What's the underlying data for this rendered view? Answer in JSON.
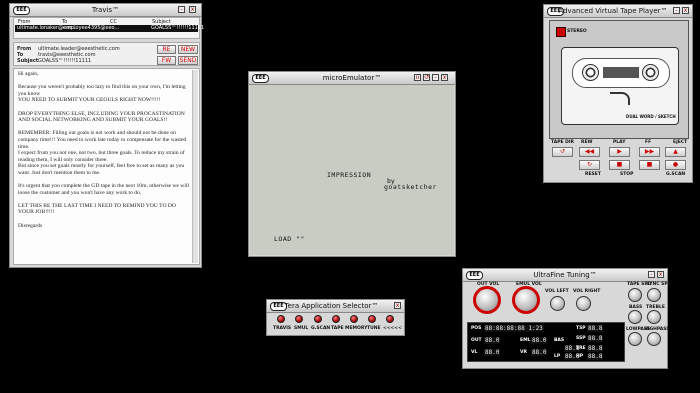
{
  "travis": {
    "title": "Travis™",
    "headers": [
      "From",
      "To",
      "CC",
      "Subject"
    ],
    "row": [
      "ultimate.lonaker@eeo...",
      "employee4395@eeo...",
      "",
      "GOALSS™!!!!!!11111"
    ],
    "from_label": "From",
    "to_label": "To",
    "subject_label": "Subject",
    "from": "ultimate.leader@eeesthetic.com",
    "to": "travis@eeesthetic.com",
    "subject": "GOALSS™!!!!!!11111",
    "buttons": [
      "RE",
      "NEW",
      "FW",
      "SEND"
    ],
    "body": [
      "Hi again,",
      "",
      "Because you weren't probably too lazy to find this on your own, I'm letting you know",
      "YOU NEED TO SUBMIT YOUR GEOULS RIGHT NOW!!!!!",
      "",
      "DROP EVERYTHING ELSE, INCLUDING YOUR PROCASTINATION AND SOCIAL NETWORKING AND SUBMIT YOUR GOALS!!",
      "",
      "REMEMBER: Filling out goals is not work and should not be done on company time!!! You need to work late today to compensate for the wasted time.",
      "I expect from you not one, not two, but three goals. To reduce my strain of reading them, I will only consider three.",
      "But since you set goals mostly for yourself, feel free to set as many as you want. Just don't mention them to me.",
      "",
      "It's urgent that you complete the GD tape in the next 10m, otherwise we will loose the customer and you won't have any work to do.",
      "",
      "LET THIS BE THE LAST TIME I NEED TO REMIND YOU TO DO YOUR JOB!!!!!",
      "",
      "Disregards"
    ]
  },
  "emulator": {
    "title": "microEmulator™",
    "line1": "IMPRESSION",
    "line2": "by",
    "line3": "goatsketcher",
    "load": "LOAD \"\""
  },
  "tape": {
    "title": "Advanced Virtual Tape Player™",
    "stereo": "STEREO",
    "label": "DUAL WORD / SKETCH",
    "top_labels": [
      "TAPE DIR",
      "REW",
      "PLAY",
      "FF",
      "EJECT"
    ],
    "bottom_labels": [
      "RESET",
      "STOP",
      "G.SCAN"
    ],
    "buttons_row1": [
      "↺",
      "◀◀",
      "▶",
      "▶▶",
      "▲"
    ],
    "buttons_row2": [
      "↻",
      "■",
      "■",
      "●"
    ]
  },
  "selector": {
    "title": "Tera Application Selector™",
    "apps": [
      "TRAVIS",
      "SMUL",
      "G.SCAN",
      "TAPE",
      "MEMORY",
      "TUNE",
      "<<<<<"
    ]
  },
  "tuning": {
    "title": "UltraFine Tuning™",
    "knob_labels": [
      "OUT VOL",
      "EMUL VOL",
      "VOL LEFT",
      "VOL RIGHT",
      "TAPE SPD",
      "SYNC SPD",
      "BASS",
      "TREBLE",
      "LOWPASS",
      "HIGHPASS"
    ],
    "readouts": [
      {
        "label": "POS",
        "value": "88:88:88:88 1:23"
      },
      {
        "label": "TSP",
        "value": "88.8"
      },
      {
        "label": "SSP",
        "value": "88.8"
      },
      {
        "label": "OUT",
        "value": "88.0"
      },
      {
        "label": "EML",
        "value": "88.0"
      },
      {
        "label": "BAS",
        "value": "88.8"
      },
      {
        "label": "TRE",
        "value": "88.8"
      },
      {
        "label": "VL",
        "value": "88.0"
      },
      {
        "label": "VR",
        "value": "88.0"
      },
      {
        "label": "LP",
        "value": "88.8"
      },
      {
        "label": "HP",
        "value": "88.8"
      }
    ]
  }
}
